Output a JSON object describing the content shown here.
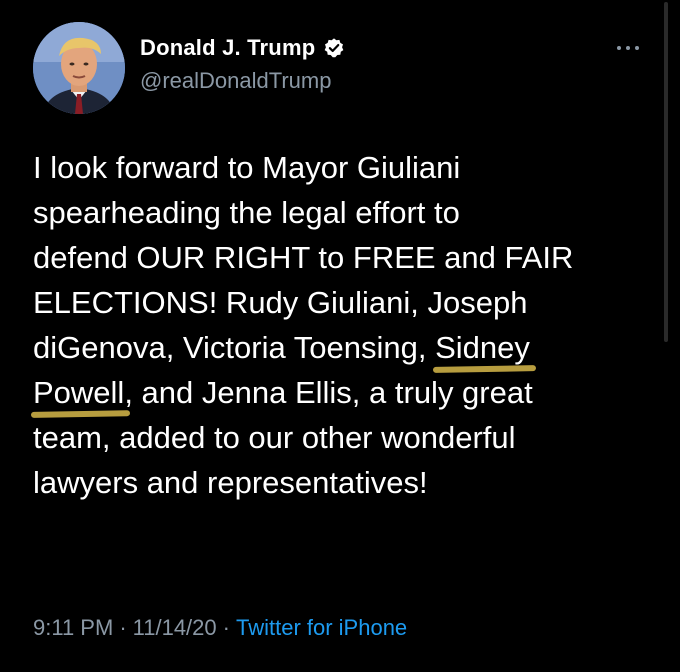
{
  "author": {
    "display_name": "Donald J. Trump",
    "handle": "@realDonaldTrump",
    "verified": true,
    "avatar_icon": "profile-avatar"
  },
  "tweet": {
    "lines": [
      "I look forward to Mayor Giuliani",
      "spearheading the legal effort to",
      "defend OUR RIGHT to FREE and FAIR",
      "ELECTIONS! Rudy Giuliani, Joseph",
      "diGenova, Victoria Toensing, ",
      "Sidney",
      "Powell",
      ", and Jenna Ellis, a truly great",
      "team, added to our other wonderful",
      "lawyers and representatives!"
    ]
  },
  "meta": {
    "time": "9:11 PM",
    "sep1": "·",
    "date": "11/14/20",
    "sep2": "·",
    "source": "Twitter for iPhone"
  },
  "colors": {
    "background": "#000000",
    "text": "#ffffff",
    "secondary": "#8b98a5",
    "link": "#1d9bf0",
    "highlight": "#d7b84a"
  },
  "icons": {
    "verified": "verified-badge-icon",
    "more": "more-options-icon"
  }
}
